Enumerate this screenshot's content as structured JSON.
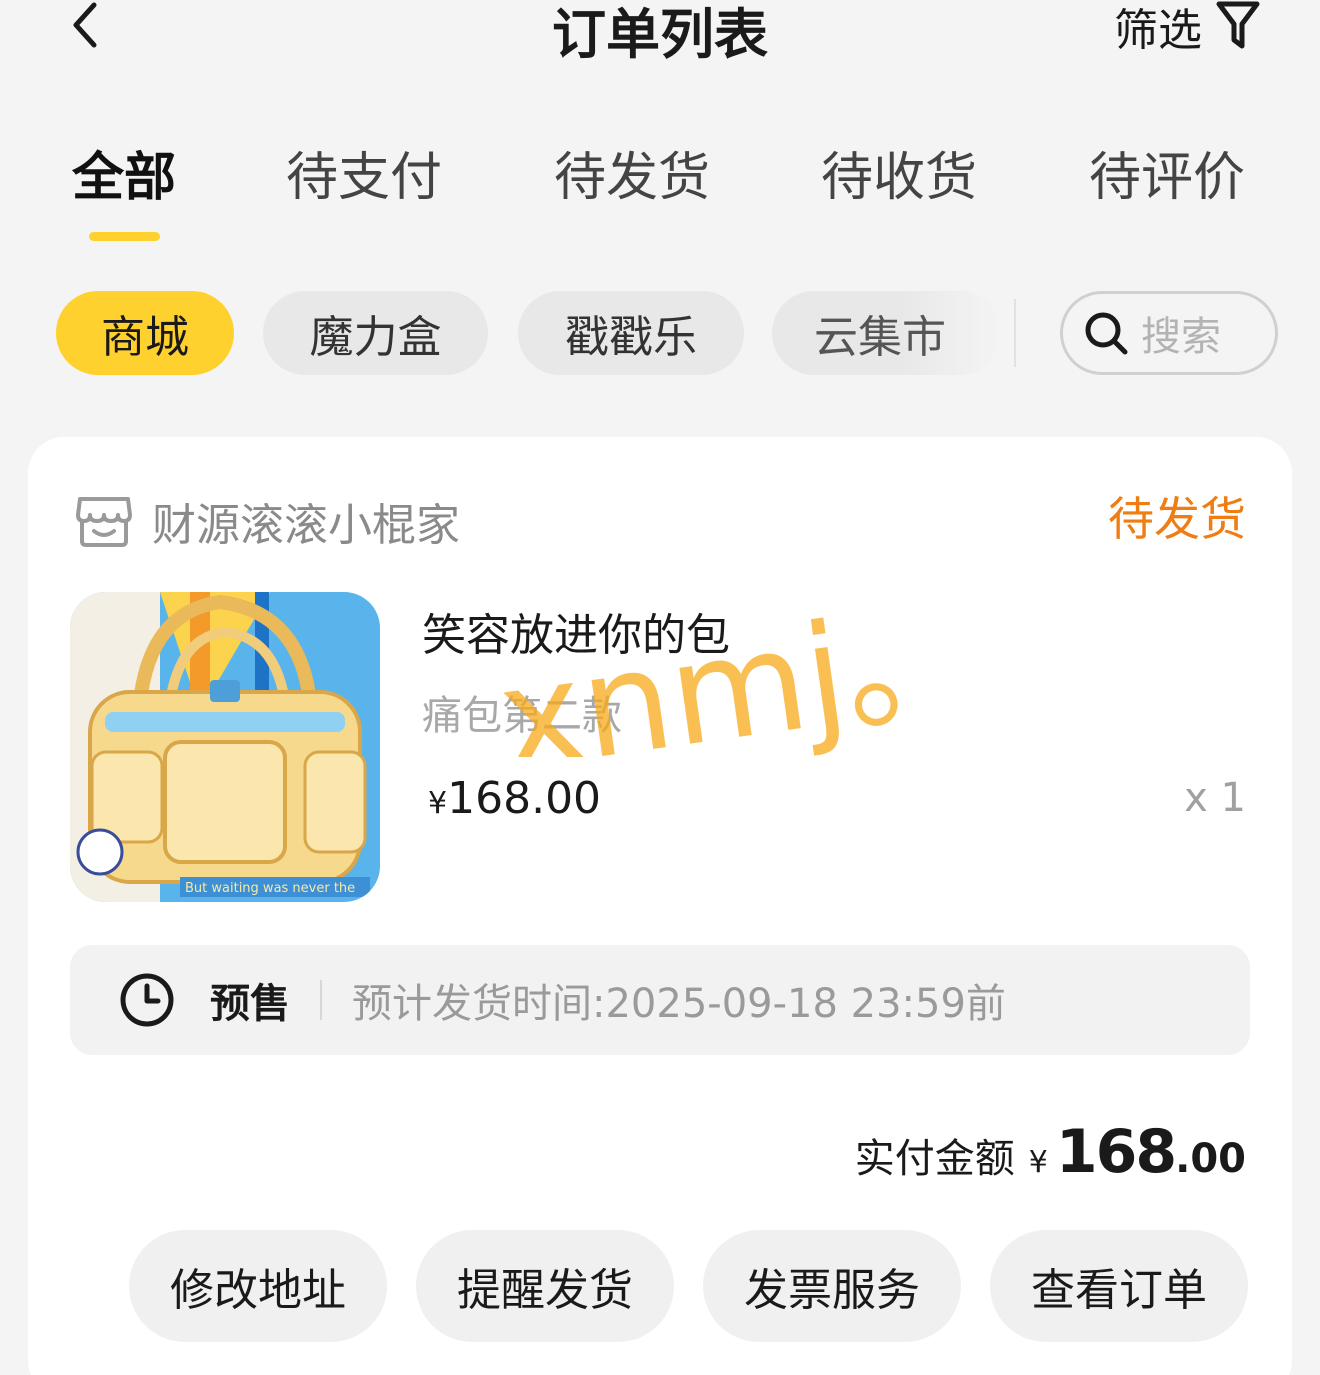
{
  "header": {
    "title": "订单列表",
    "filter_label": "筛选"
  },
  "tabs": [
    {
      "label": "全部",
      "active": true
    },
    {
      "label": "待支付",
      "active": false
    },
    {
      "label": "待发货",
      "active": false
    },
    {
      "label": "待收货",
      "active": false
    },
    {
      "label": "待评价",
      "active": false
    }
  ],
  "chips": [
    {
      "label": "商城",
      "active": true
    },
    {
      "label": "魔力盒",
      "active": false
    },
    {
      "label": "戳戳乐",
      "active": false
    },
    {
      "label": "云集市",
      "active": false
    }
  ],
  "search": {
    "placeholder": "搜索"
  },
  "order": {
    "shop_name": "财源滚滚小棍家",
    "status": "待发货",
    "status_color": "#ef7d12",
    "product": {
      "title": "笑容放进你的包",
      "variant": "痛包第二款",
      "currency": "¥",
      "price": "168.00",
      "quantity": "x 1",
      "thumbnail_caption": "But waiting was never the"
    },
    "watermark": "xnmj。",
    "presale": {
      "icon": "clock-icon",
      "label": "预售",
      "eta": "预计发货时间:2025-09-18 23:59前"
    },
    "total": {
      "label": "实付金额",
      "currency": "¥",
      "integer": "168",
      "decimal": ".00"
    },
    "actions": [
      {
        "label": "修改地址"
      },
      {
        "label": "提醒发货"
      },
      {
        "label": "发票服务"
      },
      {
        "label": "查看订单"
      }
    ]
  },
  "colors": {
    "accent_yellow": "#ffd12e",
    "status_orange": "#ef7d12",
    "background": "#f4f4f4"
  }
}
